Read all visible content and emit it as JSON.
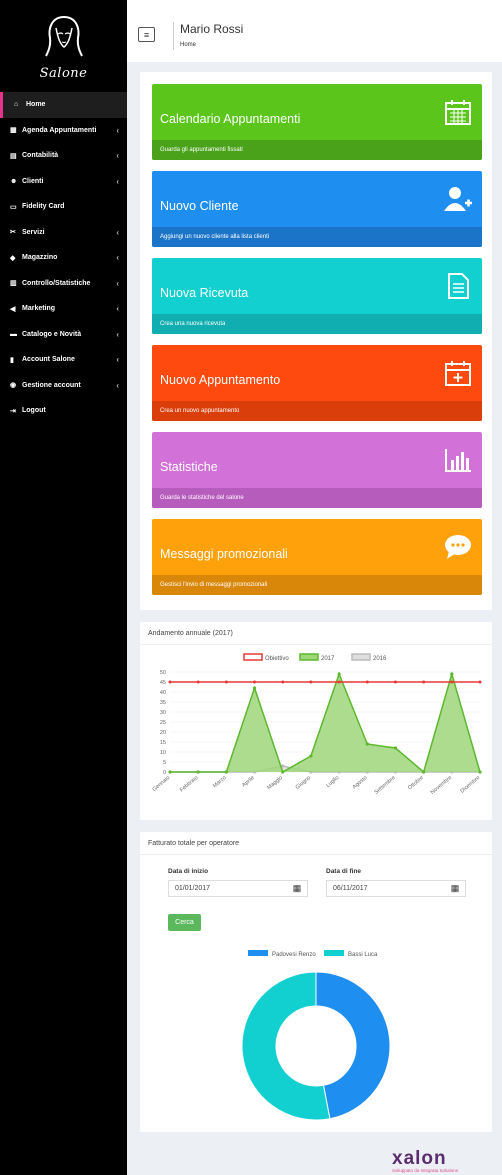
{
  "sidebar": {
    "brand": "Salone",
    "items": [
      {
        "icon": "home-icon",
        "glyph": "⌂",
        "label": "Home",
        "chevron": false,
        "active": true
      },
      {
        "icon": "calendar-icon",
        "glyph": "▦",
        "label": "Agenda Appuntamenti",
        "chevron": true
      },
      {
        "icon": "accounting-icon",
        "glyph": "▤",
        "label": "Contabilità",
        "chevron": true
      },
      {
        "icon": "users-icon",
        "glyph": "☻",
        "label": "Clienti",
        "chevron": true
      },
      {
        "icon": "card-icon",
        "glyph": "▭",
        "label": "Fidelity Card",
        "chevron": false
      },
      {
        "icon": "scissors-icon",
        "glyph": "✂",
        "label": "Servizi",
        "chevron": true
      },
      {
        "icon": "cubes-icon",
        "glyph": "◆",
        "label": "Magazzino",
        "chevron": true
      },
      {
        "icon": "chart-icon",
        "glyph": "▥",
        "label": "Controllo/Statistiche",
        "chevron": true
      },
      {
        "icon": "bullhorn-icon",
        "glyph": "◀",
        "label": "Marketing",
        "chevron": true
      },
      {
        "icon": "catalog-icon",
        "glyph": "▬",
        "label": "Catalogo e Novità",
        "chevron": true
      },
      {
        "icon": "building-icon",
        "glyph": "▮",
        "label": "Account Salone",
        "chevron": true
      },
      {
        "icon": "user-circle-icon",
        "glyph": "◉",
        "label": "Gestione account",
        "chevron": true
      },
      {
        "icon": "logout-icon",
        "glyph": "⇥",
        "label": "Logout",
        "chevron": false
      }
    ]
  },
  "header": {
    "menu_glyph": "≡",
    "user_name": "Mario Rossi",
    "breadcrumb": "Home"
  },
  "tiles": [
    {
      "title": "Calendario Appuntamenti",
      "footer": "Guarda gli appuntamenti fissati",
      "color": "#5cc51b",
      "footer_color": "#4aa21a",
      "icon": "calendar-icon"
    },
    {
      "title": "Nuovo Cliente",
      "footer": "Aggiungi un nuovo cliente alla lista clienti",
      "color": "#1f8ef1",
      "footer_color": "#1b74c7",
      "icon": "add-user-icon"
    },
    {
      "title": "Nuova Ricevuta",
      "footer": "Crea una nuova ricevuta",
      "color": "#12cfd0",
      "footer_color": "#10aeb0",
      "icon": "document-icon"
    },
    {
      "title": "Nuovo Appuntamento",
      "footer": "Crea un nuovo appuntamento",
      "color": "#ff4a0f",
      "footer_color": "#d93e0b",
      "icon": "calendar-plus-icon"
    },
    {
      "title": "Statistiche",
      "footer": "Guarda le statistiche del salone",
      "color": "#d272d8",
      "footer_color": "#b65cbc",
      "icon": "bar-chart-icon"
    },
    {
      "title": "Messaggi promozionali",
      "footer": "Gestisci l'invio di messaggi promozionali",
      "color": "#ffa10a",
      "footer_color": "#d98709",
      "icon": "chat-icon"
    }
  ],
  "annual_chart": {
    "panel_title": "Andamento annuale (2017)"
  },
  "operator_panel": {
    "title": "Fatturato totale per operatore",
    "start_label": "Data di inizio",
    "start_value": "01/01/2017",
    "end_label": "Data di fine",
    "end_value": "06/11/2017",
    "search_label": "Cerca",
    "cal_glyph": "▦"
  },
  "footer": {
    "logo": "xalon",
    "tagline": "Sviluppato da Integrata Solutions"
  },
  "chart_data": [
    {
      "type": "area",
      "title": "",
      "categories": [
        "Gennaio",
        "Febbraio",
        "Marzo",
        "Aprile",
        "Maggio",
        "Giugno",
        "Luglio",
        "Agosto",
        "Settembre",
        "Ottobre",
        "Novembre",
        "Dicembre"
      ],
      "series": [
        {
          "name": "Obiettivo",
          "type": "line",
          "color": "#e53935",
          "values": [
            45,
            45,
            45,
            45,
            45,
            45,
            45,
            45,
            45,
            45,
            45,
            45
          ]
        },
        {
          "name": "2017",
          "type": "area",
          "color": "#5cb82e",
          "fill": "#9fd67a",
          "values": [
            0,
            0,
            0,
            42,
            0,
            8,
            49,
            14,
            12,
            0,
            49,
            0
          ]
        },
        {
          "name": "2016",
          "type": "area",
          "color": "#bbbbbb",
          "fill": "#dddddd",
          "values": [
            0,
            0,
            0,
            0,
            3,
            0,
            0,
            0,
            0,
            0,
            0,
            0
          ]
        }
      ],
      "yticks": [
        0,
        5,
        10,
        15,
        20,
        25,
        30,
        35,
        40,
        45,
        50
      ],
      "ylim": [
        0,
        50
      ],
      "legend": "top"
    },
    {
      "type": "pie",
      "title": "",
      "categories": [
        "Padovesi Renzo",
        "Bassi Luca"
      ],
      "values": [
        47,
        53
      ],
      "colors": [
        "#1f8ef1",
        "#12cfd0"
      ],
      "legend": "top"
    }
  ]
}
